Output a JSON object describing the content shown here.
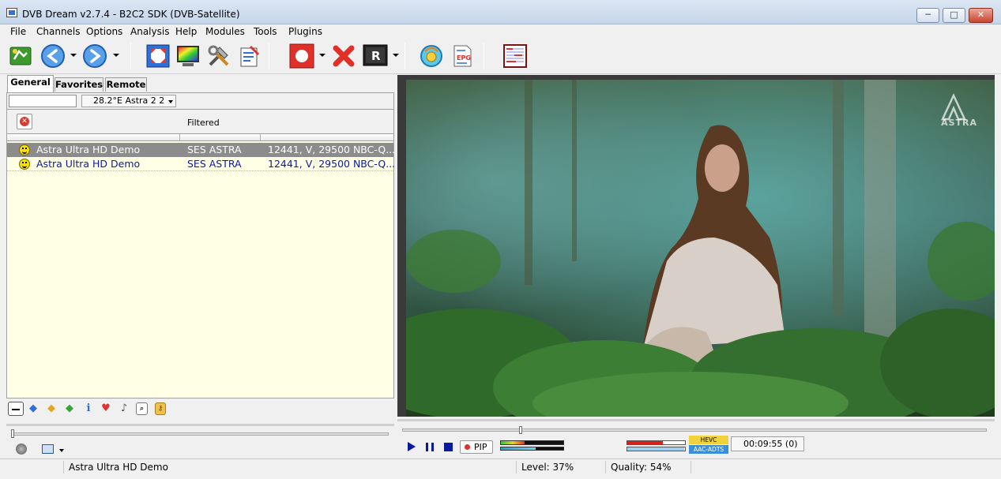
{
  "window": {
    "title": "DVB Dream v2.7.4 - B2C2 SDK (DVB-Satellite)",
    "minimize": "─",
    "maximize": "□",
    "close": "✕"
  },
  "menu": {
    "items": [
      "File",
      "Channels",
      "Options",
      "Analysis",
      "Help",
      "Modules",
      "Tools",
      "Plugins"
    ]
  },
  "tabs": [
    "General",
    "Favorites",
    "Remote"
  ],
  "filter": {
    "input_value": "",
    "satellite": "28.2°E Astra 2  2",
    "filtered_label": "Filtered"
  },
  "channels": [
    {
      "name": "Astra Ultra HD Demo",
      "provider": "SES ASTRA",
      "info": "12441, V, 29500 NBC-Q...",
      "selected": true
    },
    {
      "name": "Astra Ultra HD Demo",
      "provider": "SES ASTRA",
      "info": "12441, V, 29500 NBC-Q...",
      "selected": false
    }
  ],
  "player": {
    "pip_label": "PIP",
    "video_codec": "HEVC",
    "audio_codec": "AAC-ADTS",
    "time": "00:09:55  (0)",
    "seek_position": 0.2
  },
  "video": {
    "logo_text": "ASTRA"
  },
  "status": {
    "channel": "Astra Ultra HD Demo",
    "level": "Level: 37%",
    "quality": "Quality: 54%"
  },
  "colors": {
    "list_background": "#ffffe6",
    "channel_text": "#0b1a9c",
    "selected_row": "#8c8c8c",
    "record": "#e0302a"
  }
}
